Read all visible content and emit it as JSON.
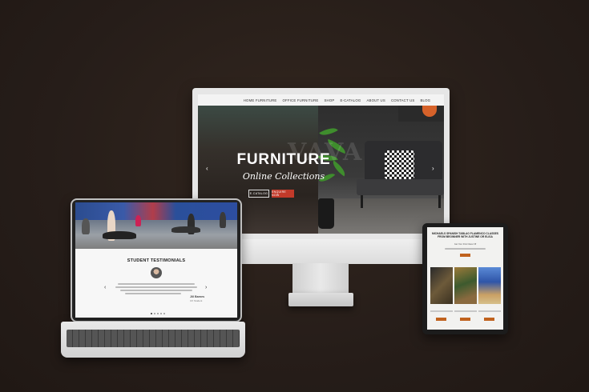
{
  "colors": {
    "background": "#2a201c",
    "accent_red": "#c23a2a",
    "accent_orange": "#c0621d",
    "device_silver": "#e6e6e6"
  },
  "desktop": {
    "nav_items": [
      "HOME FURNITURE",
      "OFFICE FURNITURE",
      "SHOP",
      "E-CATALOG",
      "ABOUT US",
      "CONTACT US",
      "BLOG"
    ],
    "hero": {
      "watermark": "VAVA",
      "title": "FURNITURE",
      "subtitle": "Online Collections",
      "button_primary": "E-CATALOG",
      "button_secondary": "ENQUIRE NOW",
      "prev_icon": "‹",
      "next_icon": "›"
    }
  },
  "laptop": {
    "heading": "STUDENT TESTIMONIALS",
    "author": "Jill Barnes",
    "author_role": "UX Student",
    "prev_icon": "‹",
    "next_icon": "›"
  },
  "tablet": {
    "heading": "MICHAELS SPANISH TABLAO FLAMENCO CLASSES FROM BEGINNER WITH JUSTINE OR ELISA",
    "subheading": "Get Your First Class Off"
  }
}
